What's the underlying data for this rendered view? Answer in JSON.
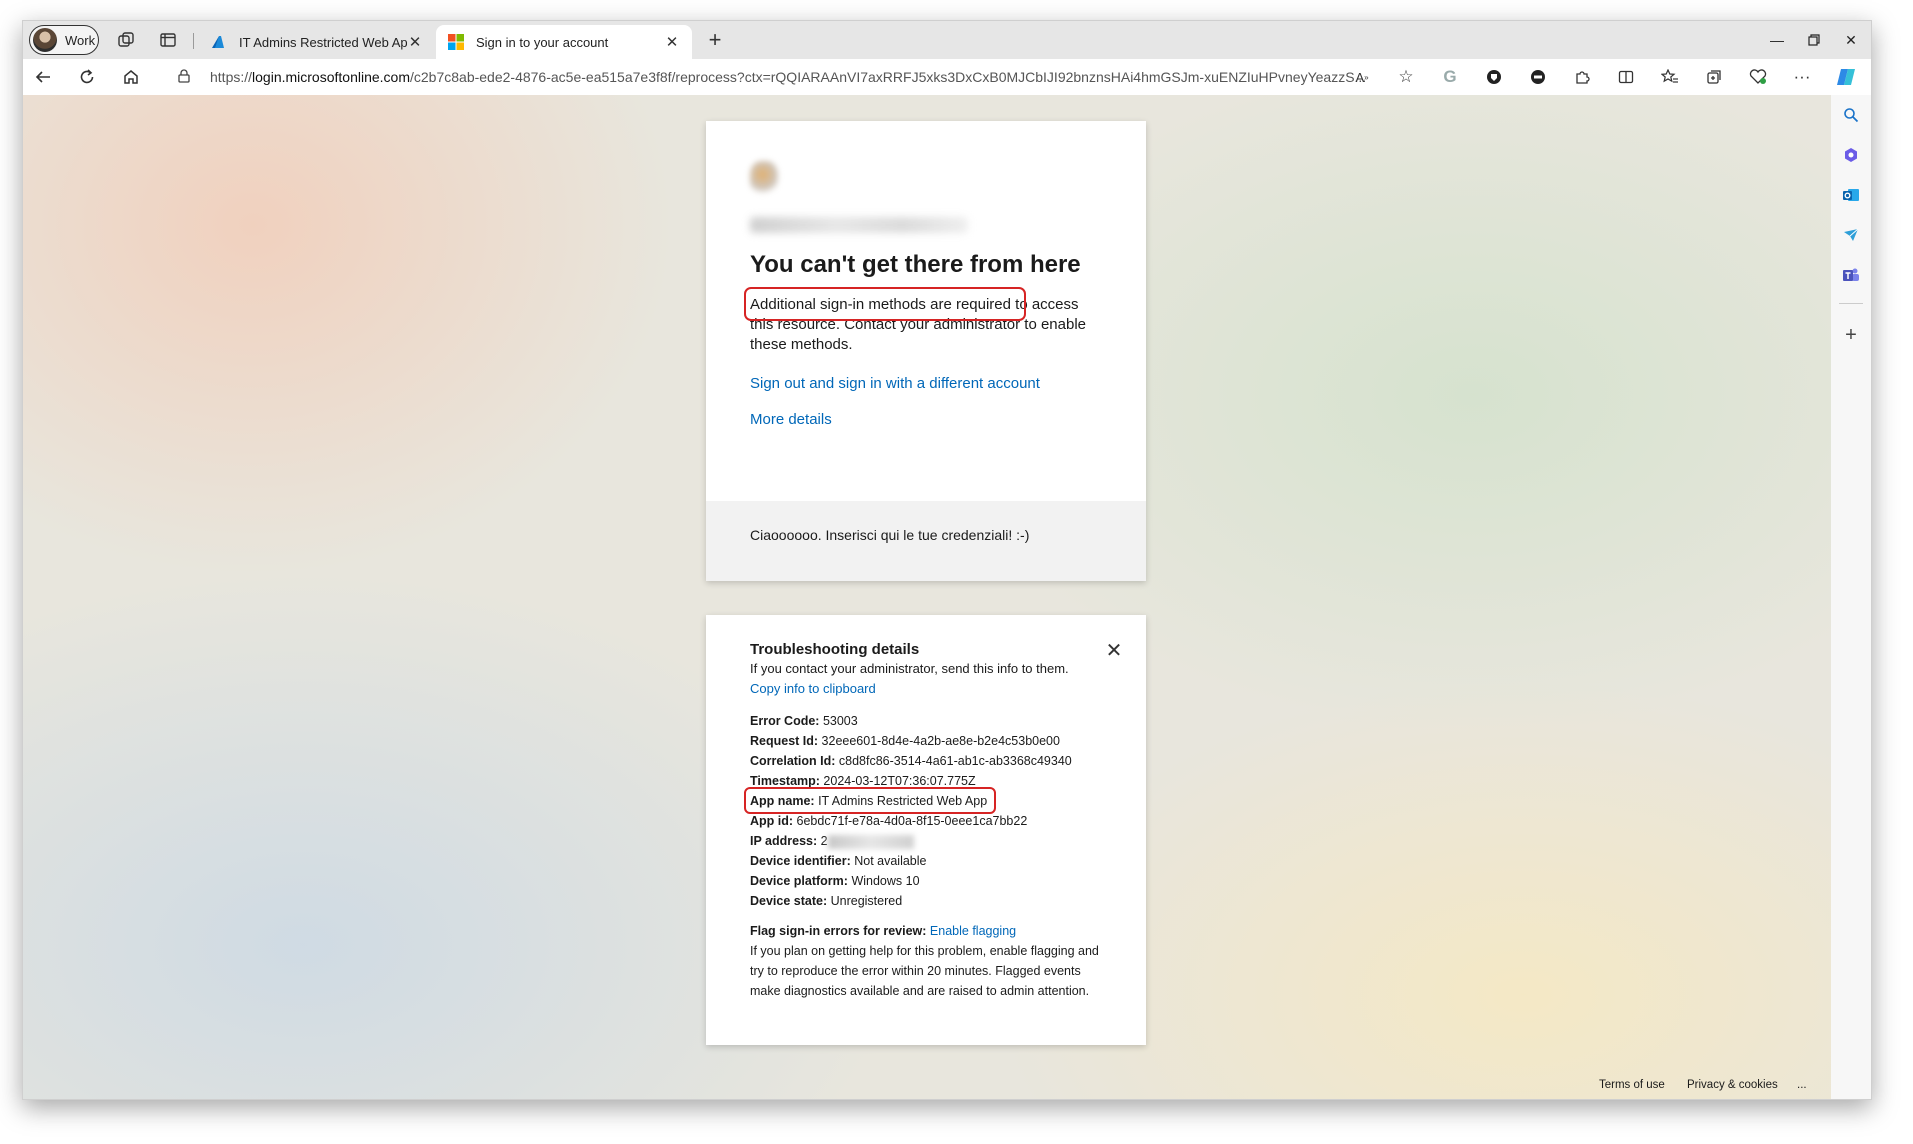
{
  "browser": {
    "profile_label": "Work",
    "tabs": [
      {
        "label": "IT Admins Restricted Web App -"
      },
      {
        "label": "Sign in to your account"
      }
    ],
    "url_prefix": "https://",
    "url_host": "login.microsoftonline.com",
    "url_rest": "/c2b7c8ab-ede2-4876-ac5e-ea515a7e3f8f/reprocess?ctx=rQQIARAAnVI7axRRFJ5xks3DxCxB0MJCbIJI92bnznsHAi4hmGSJm-xuENZIuHPvneyYeazzS..."
  },
  "signin": {
    "heading": "You can't get there from here",
    "desc_highlight": "Additional sign-in methods are required",
    "desc_rest": " to access this resource. Contact your administrator to enable these methods.",
    "link_signout": "Sign out and sign in with a different account",
    "link_details": "More details",
    "footer": "Ciaoooooo. Inserisci qui le tue credenziali! :-)"
  },
  "troubleshooting": {
    "title": "Troubleshooting details",
    "subtitle": "If you contact your administrator, send this info to them.",
    "copy_link": "Copy info to clipboard",
    "fields": {
      "error_code": {
        "label": "Error Code:",
        "value": "53003"
      },
      "request_id": {
        "label": "Request Id:",
        "value": "32eee601-8d4e-4a2b-ae8e-b2e4c53b0e00"
      },
      "correlation_id": {
        "label": "Correlation Id:",
        "value": "c8d8fc86-3514-4a61-ab1c-ab3368c49340"
      },
      "timestamp": {
        "label": "Timestamp:",
        "value": "2024-03-12T07:36:07.775Z"
      },
      "app_name": {
        "label": "App name:",
        "value": "IT Admins Restricted Web App"
      },
      "app_id": {
        "label": "App id:",
        "value": "6ebdc71f-e78a-4d0a-8f15-0eee1ca7bb22"
      },
      "ip_address": {
        "label": "IP address:",
        "value": "2"
      },
      "device_identifier": {
        "label": "Device identifier:",
        "value": "Not available"
      },
      "device_platform": {
        "label": "Device platform:",
        "value": "Windows 10"
      },
      "device_state": {
        "label": "Device state:",
        "value": "Unregistered"
      }
    },
    "flag_label": "Flag sign-in errors for review:",
    "flag_link": "Enable flagging",
    "flag_text": "If you plan on getting help for this problem, enable flagging and try to reproduce the error within 20 minutes. Flagged events make diagnostics available and are raised to admin attention."
  },
  "footer": {
    "terms": "Terms of use",
    "privacy": "Privacy & cookies",
    "more": "..."
  }
}
